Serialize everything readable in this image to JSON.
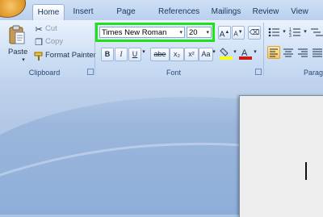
{
  "tabs": [
    "Home",
    "Insert",
    "Page Layout",
    "References",
    "Mailings",
    "Review",
    "View"
  ],
  "clipboard": {
    "paste": "Paste",
    "cut": "Cut",
    "copy": "Copy",
    "format_painter": "Format Painter",
    "group_label": "Clipboard"
  },
  "font": {
    "name": "Times New Roman",
    "size": "20",
    "bold": "B",
    "italic": "I",
    "underline": "U",
    "strike": "abe",
    "subscript": "x₂",
    "superscript": "x²",
    "change_case": "Aa",
    "grow": "A",
    "shrink": "A",
    "group_label": "Font",
    "font_color": "#cc1a1a",
    "highlight_color": "#f5ff1a"
  },
  "paragraph": {
    "group_label": "Parag"
  },
  "colors": {
    "accent_highlight": "#22e01a"
  }
}
